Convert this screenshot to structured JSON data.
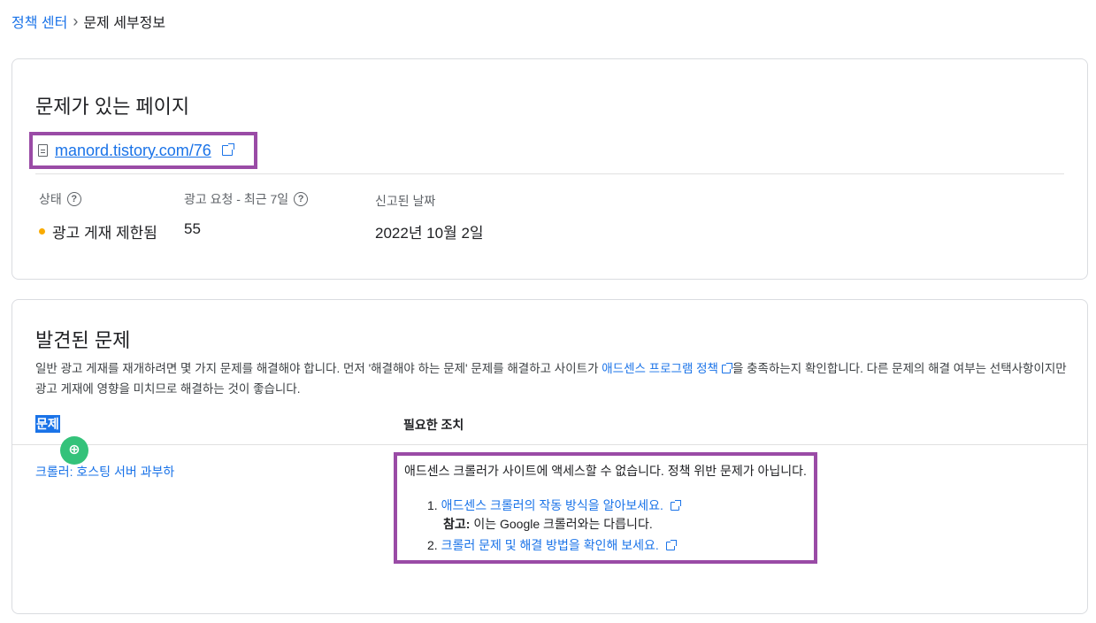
{
  "breadcrumb": {
    "root": "정책 센터",
    "current": "문제 세부정보"
  },
  "page_section": {
    "title": "문제가 있는 페이지",
    "url": "manord.tistory.com/76",
    "stats": {
      "status_label": "상태",
      "status_value": "광고 게재 제한됨",
      "requests_label": "광고 요청 - 최근 7일",
      "requests_value": "55",
      "reported_label": "신고된 날짜",
      "reported_value": "2022년 10월 2일"
    }
  },
  "issues_section": {
    "title": "발견된 문제",
    "desc_pre": "일반 광고 게재를 재개하려면 몇 가지 문제를 해결해야 합니다. 먼저 '해결해야 하는 문제' 문제를 해결하고 사이트가 ",
    "desc_link": "애드센스 프로그램 정책",
    "desc_post": "을 충족하는지 확인합니다. 다른 문제의 해결 여부는 선택사항이지만 광고 게재에 영향을 미치므로 해결하는 것이 좋습니다.",
    "col_issue": "문제",
    "col_action": "필요한 조치",
    "issue_name": "크롤러: 호스팅 서버 과부하",
    "action_text": "애드센스 크롤러가 사이트에 액세스할 수 없습니다. 정책 위반 문제가 아닙니다.",
    "step1_num": "1.",
    "step1_link": "애드센스 크롤러의 작동 방식을 알아보세요.",
    "note_label": "참고:",
    "note_text": " 이는 Google 크롤러와는 다릅니다.",
    "step2_num": "2.",
    "step2_link": "크롤러 문제 및 해결 방법을 확인해 보세요."
  },
  "icons": {
    "fab": "search-zoom-icon"
  },
  "colors": {
    "accent": "#1a73e8",
    "highlight_box": "#9a4ba6",
    "status_dot": "#f9ab00",
    "fab": "#34c27a"
  }
}
